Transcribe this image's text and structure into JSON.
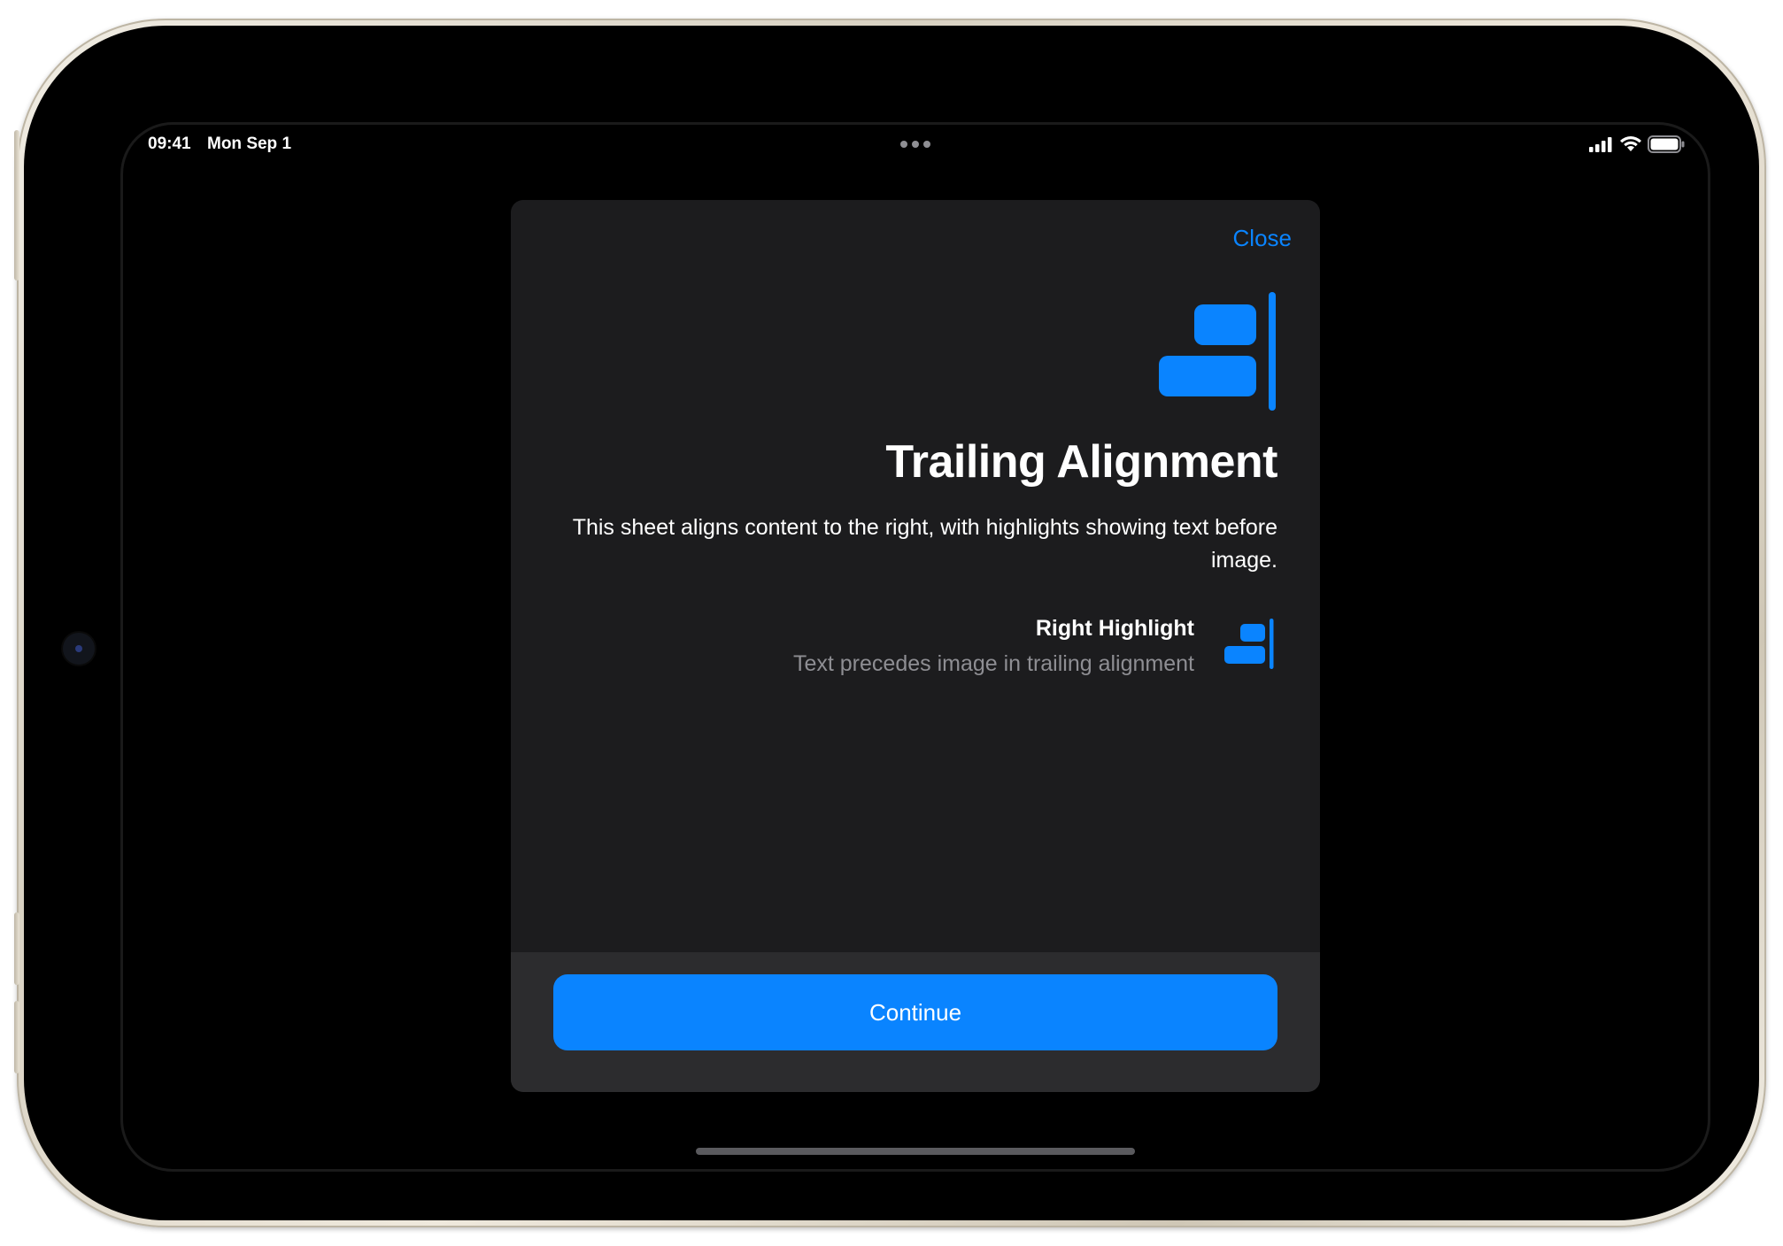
{
  "status_bar": {
    "time": "09:41",
    "date": "Mon Sep 1"
  },
  "sheet": {
    "close_label": "Close",
    "title": "Trailing Alignment",
    "body": "This sheet aligns content to the right, with highlights showing text before image.",
    "highlight": {
      "title": "Right Highlight",
      "subtitle": "Text precedes image in trailing alignment",
      "icon": "align-trailing-icon"
    },
    "hero_icon": "align-trailing-icon",
    "continue_label": "Continue"
  },
  "colors": {
    "accent": "#0a84ff",
    "sheet_background": "#1c1c1e",
    "footer_background": "#2c2c2e",
    "secondary_text": "#8e8e93",
    "screen_background": "#000000"
  }
}
